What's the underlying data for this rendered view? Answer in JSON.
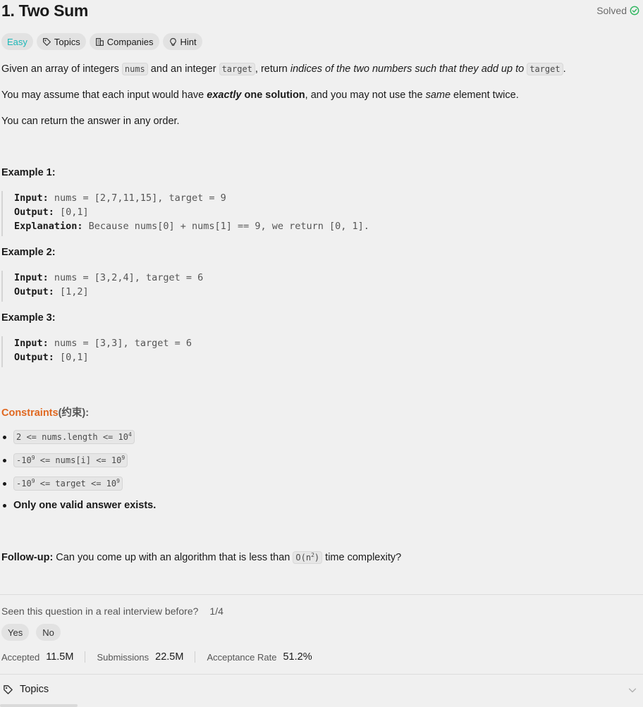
{
  "header": {
    "title": "1. Two Sum",
    "status": "Solved"
  },
  "tags": {
    "difficulty": "Easy",
    "topics": "Topics",
    "companies": "Companies",
    "hint": "Hint"
  },
  "description": {
    "p1_a": "Given an array of integers ",
    "p1_code1": "nums",
    "p1_b": " and an integer ",
    "p1_code2": "target",
    "p1_c": ", return ",
    "p1_em": "indices of the two numbers such that they add up to",
    "p1_code3": "target",
    "p1_d": ".",
    "p2_a": "You may assume that each input would have ",
    "p2_em": "exactly",
    "p2_strong": " one solution",
    "p2_b": ", and you may not use the ",
    "p2_em2": "same",
    "p2_c": " element twice.",
    "p3": "You can return the answer in any order."
  },
  "examples": [
    {
      "title": "Example 1:",
      "input_label": "Input:",
      "input": " nums = [2,7,11,15], target = 9",
      "output_label": "Output:",
      "output": " [0,1]",
      "explanation_label": "Explanation:",
      "explanation": " Because nums[0] + nums[1] == 9, we return [0, 1]."
    },
    {
      "title": "Example 2:",
      "input_label": "Input:",
      "input": " nums = [3,2,4], target = 6",
      "output_label": "Output:",
      "output": " [1,2]"
    },
    {
      "title": "Example 3:",
      "input_label": "Input:",
      "input": " nums = [3,3], target = 6",
      "output_label": "Output:",
      "output": " [0,1]"
    }
  ],
  "constraints": {
    "title_orange": "Constraints",
    "title_rest": "(约束):",
    "c1_a": "2 <= nums.length <= 10",
    "c1_sup": "4",
    "c2_a": "-10",
    "c2_sup1": "9",
    "c2_b": " <= nums[i] <= 10",
    "c2_sup2": "9",
    "c3_a": "-10",
    "c3_sup1": "9",
    "c3_b": " <= target <= 10",
    "c3_sup2": "9",
    "c4": "Only one valid answer exists."
  },
  "followup": {
    "label": "Follow-up:",
    "text_a": " Can you come up with an algorithm that is less than ",
    "code_a": "O(n",
    "code_sup": "2",
    "code_b": ")",
    "text_b": " time complexity?"
  },
  "interview": {
    "question": "Seen this question in a real interview before?",
    "count": "1/4",
    "yes": "Yes",
    "no": "No"
  },
  "stats": {
    "accepted_label": "Accepted",
    "accepted_value": "11.5M",
    "submissions_label": "Submissions",
    "submissions_value": "22.5M",
    "acceptance_label": "Acceptance Rate",
    "acceptance_value": "51.2%"
  },
  "topics_section": {
    "label": "Topics"
  },
  "colors": {
    "easy": "#1cb8b8",
    "solved_check": "#2cb55d",
    "constraints_orange": "#e0671f"
  }
}
